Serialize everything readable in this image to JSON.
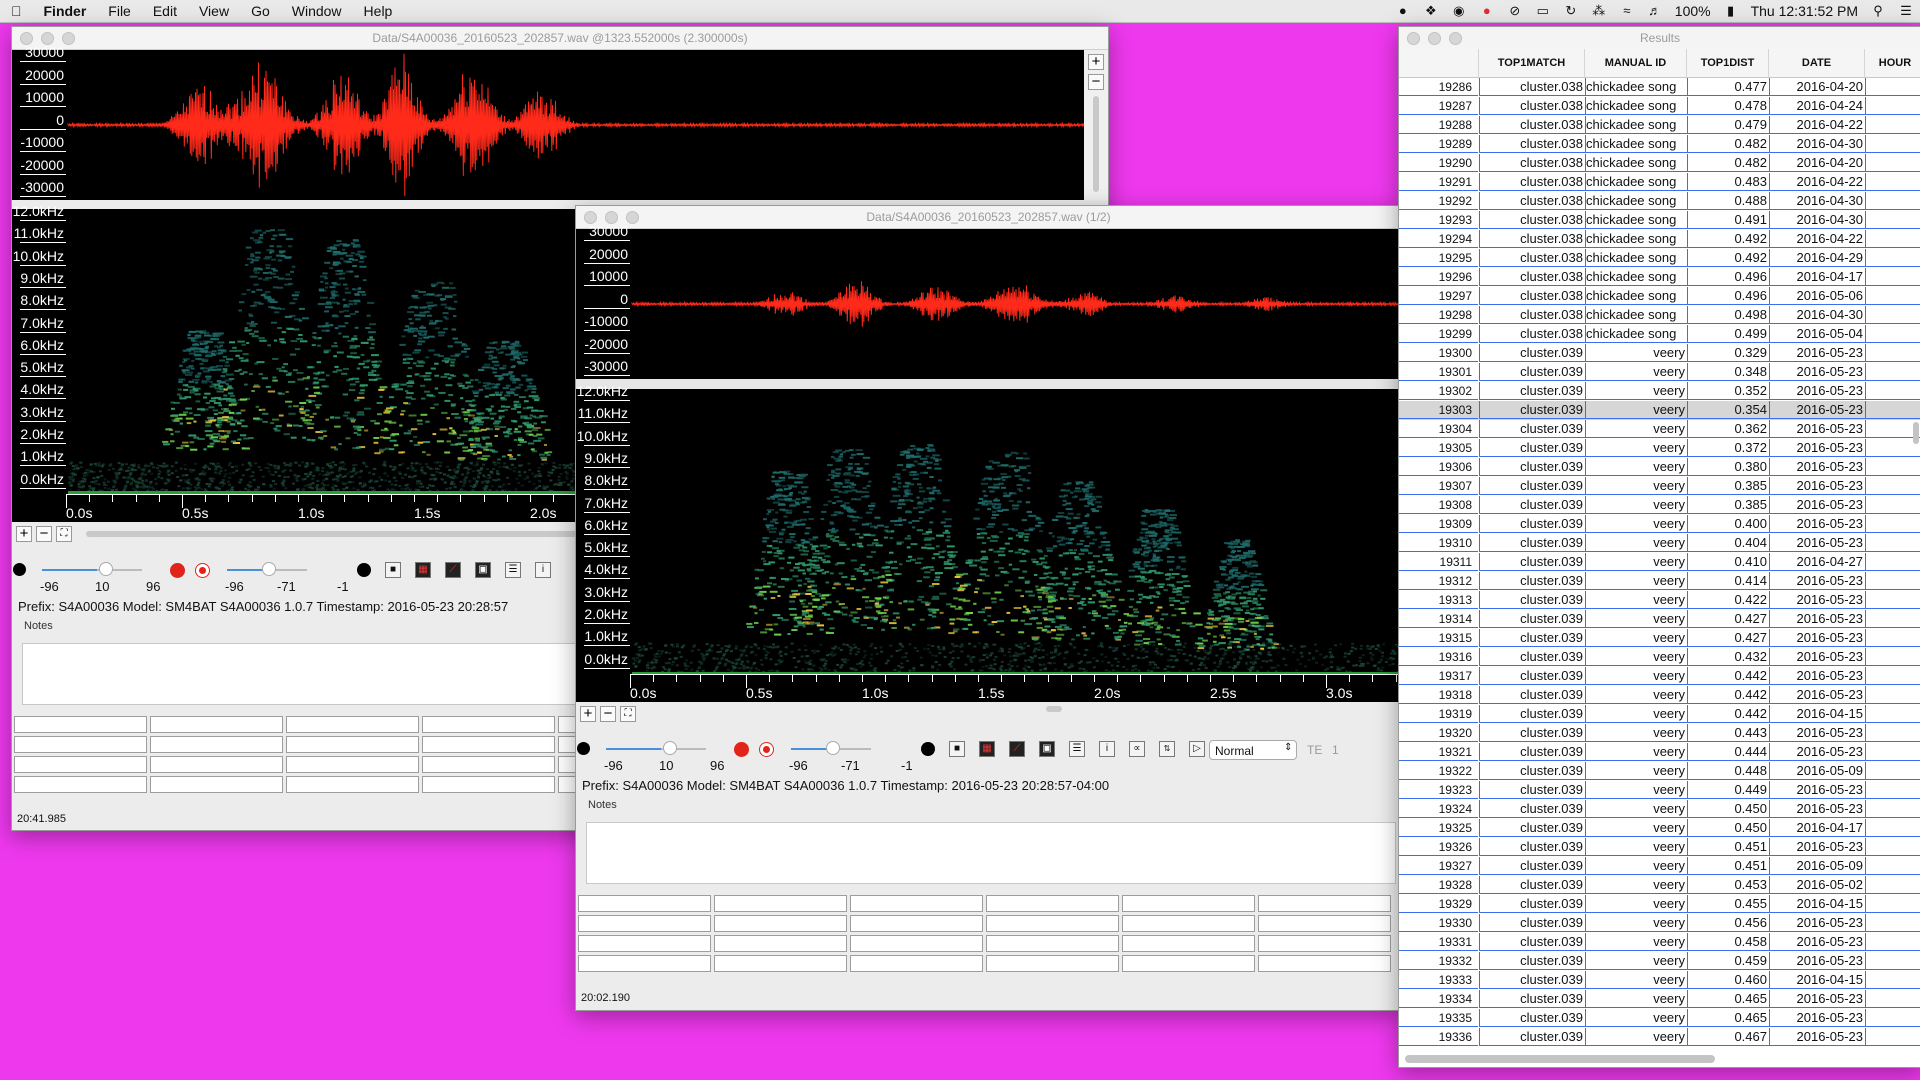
{
  "menubar": {
    "apple": "",
    "app": "Finder",
    "items": [
      "File",
      "Edit",
      "View",
      "Go",
      "Window",
      "Help"
    ],
    "battery": "100%",
    "clock": "Thu 12:31:52 PM"
  },
  "window1": {
    "title": "Data/S4A00036_20160523_202857.wav @1323.552000s (2.300000s)",
    "wave_labels": [
      "30000",
      "20000",
      "10000",
      "0",
      "-10000",
      "-20000",
      "-30000"
    ],
    "freq_labels": [
      "12.0kHz",
      "11.0kHz",
      "10.0kHz",
      "9.0kHz",
      "8.0kHz",
      "7.0kHz",
      "6.0kHz",
      "5.0kHz",
      "4.0kHz",
      "3.0kHz",
      "2.0kHz",
      "1.0kHz",
      "0.0kHz"
    ],
    "time_labels": [
      "0.0s",
      "0.5s",
      "1.0s",
      "1.5s",
      "2.0s"
    ],
    "slider1": {
      "min": "-96",
      "val": "10",
      "max": "96"
    },
    "slider2": {
      "min": "-96",
      "val": "-71",
      "max": "-1"
    },
    "info": "Prefix: S4A00036    Model: SM4BAT S4A00036 1.0.7    Timestamp: 2016-05-23 20:28:57",
    "notes_label": "Notes",
    "status": "20:41.985"
  },
  "window2": {
    "title": "Data/S4A00036_20160523_202857.wav (1/2)",
    "wave_labels": [
      "30000",
      "20000",
      "10000",
      "0",
      "-10000",
      "-20000",
      "-30000"
    ],
    "freq_labels": [
      "12.0kHz",
      "11.0kHz",
      "10.0kHz",
      "9.0kHz",
      "8.0kHz",
      "7.0kHz",
      "6.0kHz",
      "5.0kHz",
      "4.0kHz",
      "3.0kHz",
      "2.0kHz",
      "1.0kHz",
      "0.0kHz"
    ],
    "time_labels": [
      "0.0s",
      "0.5s",
      "1.0s",
      "1.5s",
      "2.0s",
      "2.5s",
      "3.0s"
    ],
    "slider1": {
      "min": "-96",
      "val": "10",
      "max": "96"
    },
    "slider2": {
      "min": "-96",
      "val": "-71",
      "max": "-1"
    },
    "mode_select": "Normal",
    "te_label": "TE",
    "te_value": "1",
    "info": "Prefix: S4A00036    Model: SM4BAT S4A00036 1.0.7    Timestamp: 2016-05-23 20:28:57-04:00",
    "notes_label": "Notes",
    "status": "20:02.190"
  },
  "results": {
    "title": "Results",
    "columns": [
      "",
      "TOP1MATCH",
      "MANUAL ID",
      "TOP1DIST",
      "DATE",
      "HOUR"
    ],
    "selected_row": "19303",
    "rows": [
      [
        "19286",
        "cluster.038",
        "chickadee song",
        "0.477",
        "2016-04-20"
      ],
      [
        "19287",
        "cluster.038",
        "chickadee song",
        "0.478",
        "2016-04-24"
      ],
      [
        "19288",
        "cluster.038",
        "chickadee song",
        "0.479",
        "2016-04-22"
      ],
      [
        "19289",
        "cluster.038",
        "chickadee song",
        "0.482",
        "2016-04-30"
      ],
      [
        "19290",
        "cluster.038",
        "chickadee song",
        "0.482",
        "2016-04-20"
      ],
      [
        "19291",
        "cluster.038",
        "chickadee song",
        "0.483",
        "2016-04-22"
      ],
      [
        "19292",
        "cluster.038",
        "chickadee song",
        "0.488",
        "2016-04-30"
      ],
      [
        "19293",
        "cluster.038",
        "chickadee song",
        "0.491",
        "2016-04-30"
      ],
      [
        "19294",
        "cluster.038",
        "chickadee song",
        "0.492",
        "2016-04-22"
      ],
      [
        "19295",
        "cluster.038",
        "chickadee song",
        "0.492",
        "2016-04-29"
      ],
      [
        "19296",
        "cluster.038",
        "chickadee song",
        "0.496",
        "2016-04-17"
      ],
      [
        "19297",
        "cluster.038",
        "chickadee song",
        "0.496",
        "2016-05-06"
      ],
      [
        "19298",
        "cluster.038",
        "chickadee song",
        "0.498",
        "2016-04-30"
      ],
      [
        "19299",
        "cluster.038",
        "chickadee song",
        "0.499",
        "2016-05-04"
      ],
      [
        "19300",
        "cluster.039",
        "veery",
        "0.329",
        "2016-05-23"
      ],
      [
        "19301",
        "cluster.039",
        "veery",
        "0.348",
        "2016-05-23"
      ],
      [
        "19302",
        "cluster.039",
        "veery",
        "0.352",
        "2016-05-23"
      ],
      [
        "19303",
        "cluster.039",
        "veery",
        "0.354",
        "2016-05-23"
      ],
      [
        "19304",
        "cluster.039",
        "veery",
        "0.362",
        "2016-05-23"
      ],
      [
        "19305",
        "cluster.039",
        "veery",
        "0.372",
        "2016-05-23"
      ],
      [
        "19306",
        "cluster.039",
        "veery",
        "0.380",
        "2016-05-23"
      ],
      [
        "19307",
        "cluster.039",
        "veery",
        "0.385",
        "2016-05-23"
      ],
      [
        "19308",
        "cluster.039",
        "veery",
        "0.385",
        "2016-05-23"
      ],
      [
        "19309",
        "cluster.039",
        "veery",
        "0.400",
        "2016-05-23"
      ],
      [
        "19310",
        "cluster.039",
        "veery",
        "0.404",
        "2016-05-23"
      ],
      [
        "19311",
        "cluster.039",
        "veery",
        "0.410",
        "2016-04-27"
      ],
      [
        "19312",
        "cluster.039",
        "veery",
        "0.414",
        "2016-05-23"
      ],
      [
        "19313",
        "cluster.039",
        "veery",
        "0.422",
        "2016-05-23"
      ],
      [
        "19314",
        "cluster.039",
        "veery",
        "0.427",
        "2016-05-23"
      ],
      [
        "19315",
        "cluster.039",
        "veery",
        "0.427",
        "2016-05-23"
      ],
      [
        "19316",
        "cluster.039",
        "veery",
        "0.432",
        "2016-05-23"
      ],
      [
        "19317",
        "cluster.039",
        "veery",
        "0.442",
        "2016-05-23"
      ],
      [
        "19318",
        "cluster.039",
        "veery",
        "0.442",
        "2016-05-23"
      ],
      [
        "19319",
        "cluster.039",
        "veery",
        "0.442",
        "2016-04-15"
      ],
      [
        "19320",
        "cluster.039",
        "veery",
        "0.443",
        "2016-05-23"
      ],
      [
        "19321",
        "cluster.039",
        "veery",
        "0.444",
        "2016-05-23"
      ],
      [
        "19322",
        "cluster.039",
        "veery",
        "0.448",
        "2016-05-09"
      ],
      [
        "19323",
        "cluster.039",
        "veery",
        "0.449",
        "2016-05-23"
      ],
      [
        "19324",
        "cluster.039",
        "veery",
        "0.450",
        "2016-05-23"
      ],
      [
        "19325",
        "cluster.039",
        "veery",
        "0.450",
        "2016-04-17"
      ],
      [
        "19326",
        "cluster.039",
        "veery",
        "0.451",
        "2016-05-23"
      ],
      [
        "19327",
        "cluster.039",
        "veery",
        "0.451",
        "2016-05-09"
      ],
      [
        "19328",
        "cluster.039",
        "veery",
        "0.453",
        "2016-05-02"
      ],
      [
        "19329",
        "cluster.039",
        "veery",
        "0.455",
        "2016-04-15"
      ],
      [
        "19330",
        "cluster.039",
        "veery",
        "0.456",
        "2016-05-23"
      ],
      [
        "19331",
        "cluster.039",
        "veery",
        "0.458",
        "2016-05-23"
      ],
      [
        "19332",
        "cluster.039",
        "veery",
        "0.459",
        "2016-05-23"
      ],
      [
        "19333",
        "cluster.039",
        "veery",
        "0.460",
        "2016-04-15"
      ],
      [
        "19334",
        "cluster.039",
        "veery",
        "0.465",
        "2016-05-23"
      ],
      [
        "19335",
        "cluster.039",
        "veery",
        "0.465",
        "2016-05-23"
      ],
      [
        "19336",
        "cluster.039",
        "veery",
        "0.467",
        "2016-05-23"
      ]
    ]
  },
  "colors": {
    "desktop": "#ee38ee",
    "waveform": "#ff2a1a",
    "grid_line": "#3b6cf2",
    "spectrogram_bg": "#000000"
  }
}
